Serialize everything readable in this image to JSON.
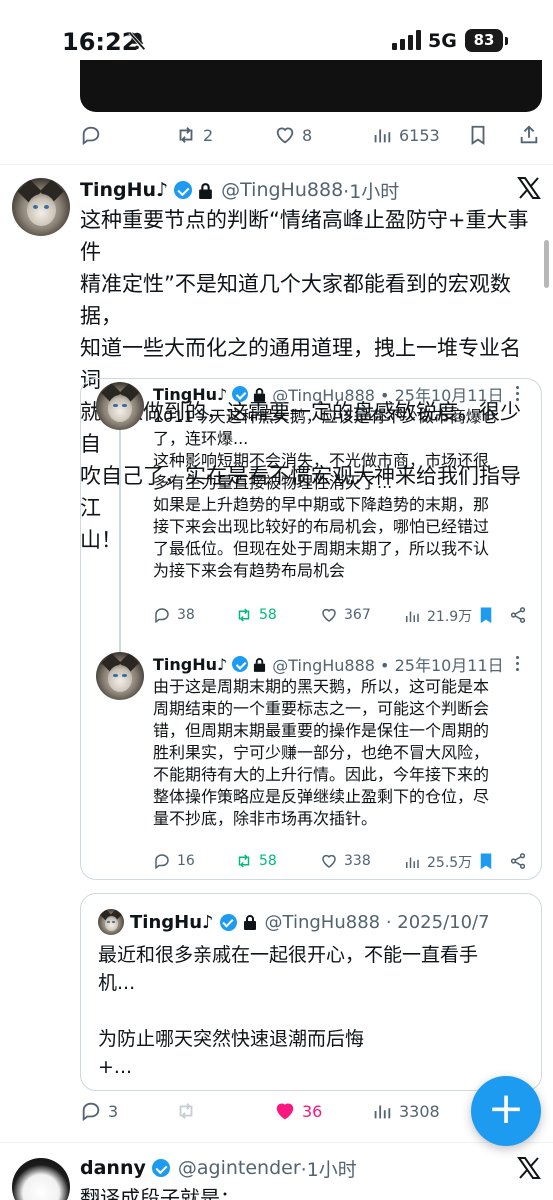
{
  "status": {
    "time": "16:22",
    "network": "5G",
    "battery": "83"
  },
  "prev_tweet": {
    "replies": "",
    "retweets": "2",
    "likes": "8",
    "views": "6153"
  },
  "tweet": {
    "name": "TingHu♪",
    "handle": "@TingHu888",
    "time": "·1小时",
    "lines": [
      "这种重要节点的判断“情绪高峰止盈防守+重大事件",
      "精准定性”不是知道几个大家都能看到的宏观数据，",
      "知道一些大而化之的通用道理，拽上一堆专业名词",
      "就可以做到的，这需要一定的盘感敏锐度。很少自",
      "吹自己了，实在是看不惯宏观大神来给我们指导江",
      "山！"
    ],
    "replies": "3",
    "retweets": "",
    "likes": "36",
    "views": "3308"
  },
  "thread": [
    {
      "name": "TingHu♪",
      "handle": "@TingHu888 • 25年10月11日",
      "lines": [
        "1011今天这种黑天鹅，应该是有不少做市商爆仓",
        "了，连环爆...",
        "这种影响短期不会消失，不光做市商，市场还很",
        "多有生力量直接被物理性消灭了...",
        "如果是上升趋势的早中期或下降趋势的末期，那",
        "接下来会出现比较好的布局机会，哪怕已经错过",
        "了最低位。但现在处于周期末期了，所以我不认",
        "为接下来会有趋势布局机会"
      ],
      "replies": "38",
      "retweets": "58",
      "likes": "367",
      "views": "21.9万"
    },
    {
      "name": "TingHu♪",
      "handle": "@TingHu888 • 25年10月11日",
      "lines": [
        "由于这是周期末期的黑天鹅，所以，这可能是本",
        "周期结束的一个重要标志之一，可能这个判断会",
        "错，但周期末期最重要的操作是保住一个周期的",
        "胜利果实，宁可少赚一部分，也绝不冒大风险，",
        "不能期待有大的上升行情。因此，今年接下来的",
        "整体操作策略应是反弹继续止盈剩下的仓位，尽",
        "量不抄底，除非市场再次插针。"
      ],
      "replies": "16",
      "retweets": "58",
      "likes": "338",
      "views": "25.5万"
    }
  ],
  "quote": {
    "name": "TingHu♪",
    "handle": "@TingHu888 · 2025/10/7",
    "lines": [
      "最近和很多亲戚在一起很开心，不能一直看手",
      "机...",
      "",
      "为防止哪天突然快速退潮而后悔",
      "+..."
    ]
  },
  "next_tweet": {
    "name": "danny",
    "handle": "@agintender",
    "time": "·1小时",
    "text": "翻译成段子就是："
  },
  "fab_label": "+",
  "icons": [
    "bell-slash-icon",
    "signal-icon",
    "reply-icon",
    "retweet-icon",
    "like-icon",
    "views-icon",
    "bookmark-icon",
    "share-icon",
    "x-logo-icon",
    "verified-icon",
    "lock-icon",
    "more-icon",
    "compose-icon"
  ]
}
